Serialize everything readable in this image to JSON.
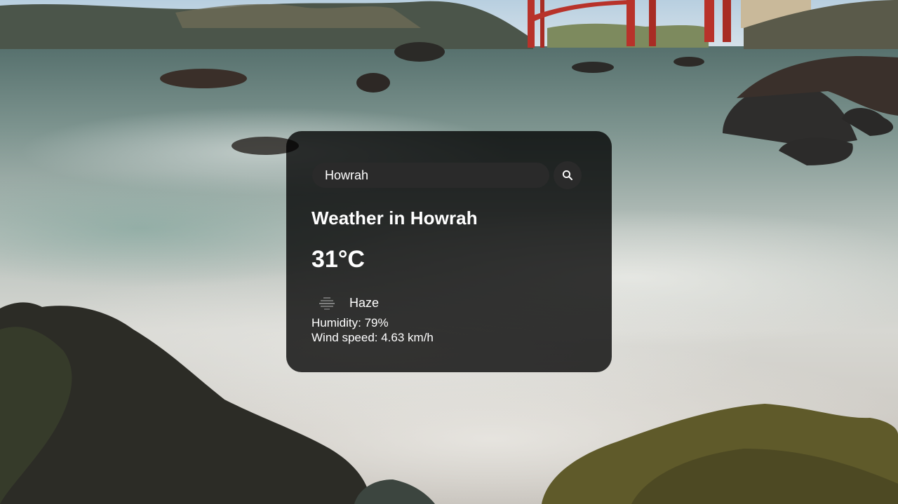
{
  "search": {
    "value": "Howrah",
    "button_icon": "search-icon"
  },
  "weather": {
    "title": "Weather in Howrah",
    "temperature": "31°C",
    "condition_icon": "haze-icon",
    "condition": "Haze",
    "humidity": "Humidity: 79%",
    "wind": "Wind speed: 4.63 km/h"
  },
  "colors": {
    "card_background": "#000000c7",
    "input_background": "#2a2a2a",
    "text": "#ffffff"
  }
}
